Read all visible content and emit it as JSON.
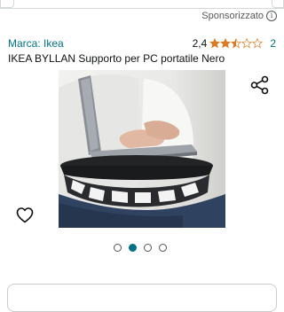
{
  "header": {
    "sponsored_label": "Sponsorizzato",
    "info_icon": "i"
  },
  "product": {
    "brand": "Marca: Ikea",
    "rating_value": "2,4",
    "rating_stars": 2.4,
    "rating_count": "2",
    "title": "IKEA BYLLAN Supporto per PC portatile Nero"
  },
  "gallery": {
    "image_count": 4,
    "active_index": 1
  },
  "colors": {
    "link": "#007185",
    "star": "#de7921",
    "dot_active": "#007185"
  }
}
